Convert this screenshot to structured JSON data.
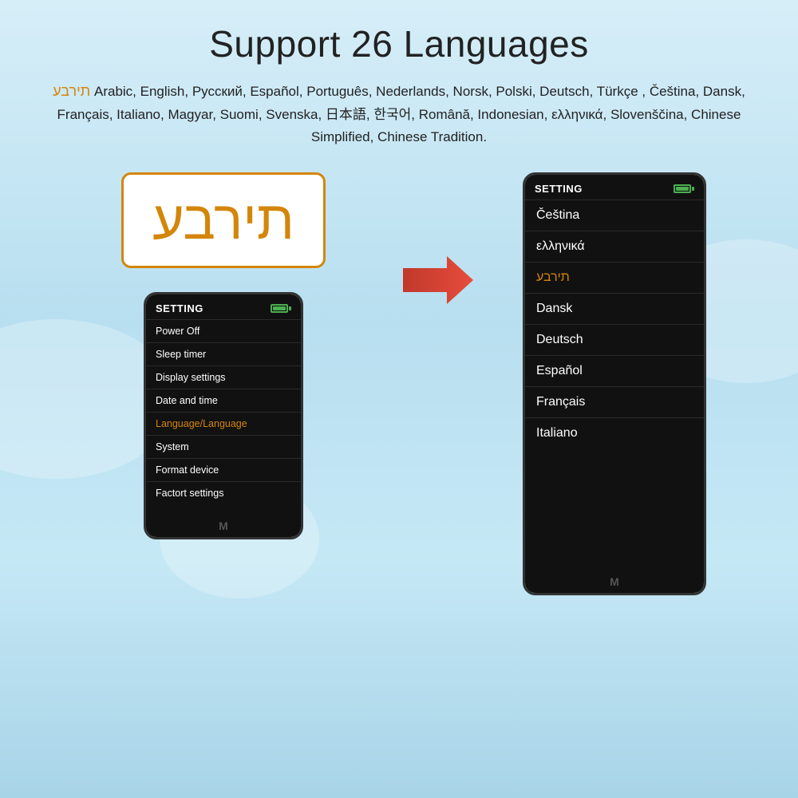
{
  "page": {
    "title": "Support 26 Languages",
    "languages_text_before_hebrew": "",
    "hebrew_inline": "תירבע",
    "languages_list": "Arabic, English, Русский, Español, Português, Nederlands, Norsk, Polski, Deutsch, Türkçe , Čeština, Dansk, Français, Italiano, Magyar, Suomi, Svenska, 日本語, 한국어, Română, Indonesian, ελληνικά, Slovenščina, Chinese Simplified, Chinese Tradition."
  },
  "hebrew_box": {
    "text": "תירבע"
  },
  "device_left": {
    "header": "SETTING",
    "battery_alt": "battery full",
    "menu_items": [
      {
        "label": "Power Off",
        "active": false
      },
      {
        "label": "Sleep timer",
        "active": false
      },
      {
        "label": "Display settings",
        "active": false
      },
      {
        "label": "Date and time",
        "active": false
      },
      {
        "label": "Language/Language",
        "active": true
      },
      {
        "label": "System",
        "active": false
      },
      {
        "label": "Format device",
        "active": false
      },
      {
        "label": "Factort settings",
        "active": false
      }
    ],
    "bottom_label": "M"
  },
  "device_right": {
    "header": "SETTING",
    "battery_alt": "battery full",
    "lang_items": [
      {
        "label": "Čeština",
        "active": false
      },
      {
        "label": "ελληνικά",
        "active": false
      },
      {
        "label": "תירבע",
        "active": true
      },
      {
        "label": "Dansk",
        "active": false
      },
      {
        "label": "Deutsch",
        "active": false
      },
      {
        "label": "Español",
        "active": false
      },
      {
        "label": "Français",
        "active": false
      },
      {
        "label": "Italiano",
        "active": false
      }
    ],
    "bottom_label": "M"
  }
}
